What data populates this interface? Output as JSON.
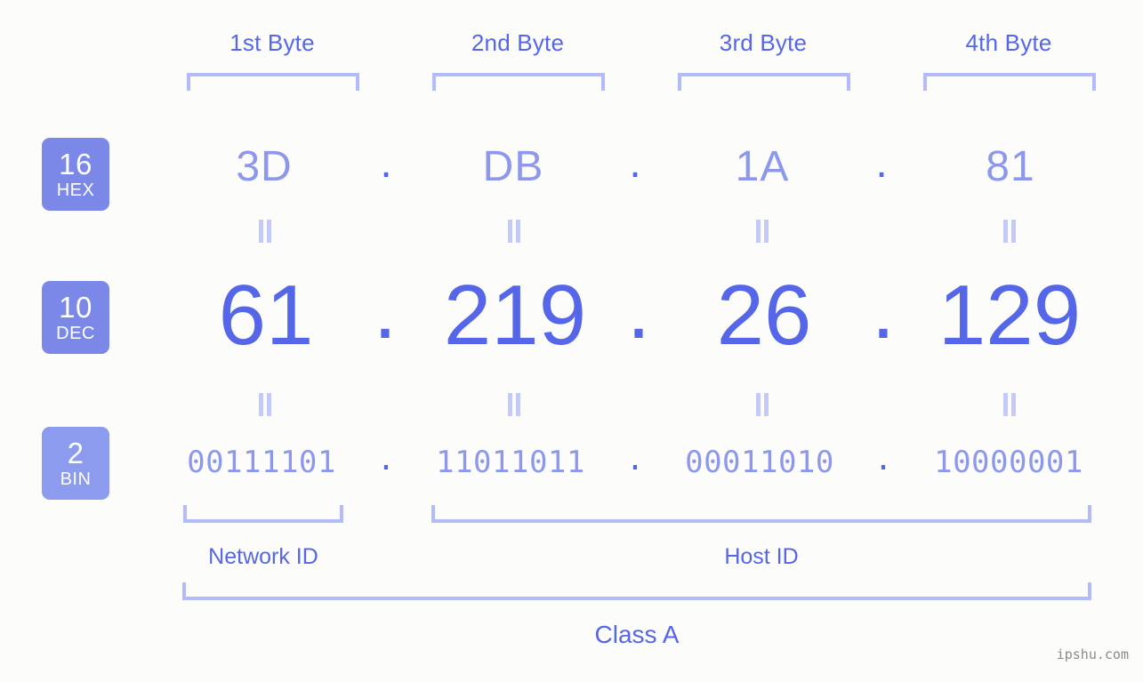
{
  "page": {
    "background_color": "#fcfdfa",
    "accent_color": "#5566e8",
    "accent_light_color": "#8d98ec",
    "bracket_color": "#b3bcf8",
    "badge_color": "#7b88e8",
    "badge_color_light": "#8d9bee"
  },
  "byte_headers": [
    {
      "label": "1st Byte"
    },
    {
      "label": "2nd Byte"
    },
    {
      "label": "3rd Byte"
    },
    {
      "label": "4th Byte"
    }
  ],
  "rows": {
    "hex": {
      "badge_number": "16",
      "badge_abbr": "HEX",
      "values": [
        "3D",
        "DB",
        "1A",
        "81"
      ],
      "separator": "."
    },
    "dec": {
      "badge_number": "10",
      "badge_abbr": "DEC",
      "values": [
        "61",
        "219",
        "26",
        "129"
      ],
      "separator": "."
    },
    "bin": {
      "badge_number": "2",
      "badge_abbr": "BIN",
      "values": [
        "00111101",
        "11011011",
        "00011010",
        "10000001"
      ],
      "separator": "."
    }
  },
  "equals_marker": "=",
  "segments": {
    "network_id": "Network ID",
    "host_id": "Host ID",
    "ip_class": "Class A"
  },
  "watermark": "ipshu.com"
}
